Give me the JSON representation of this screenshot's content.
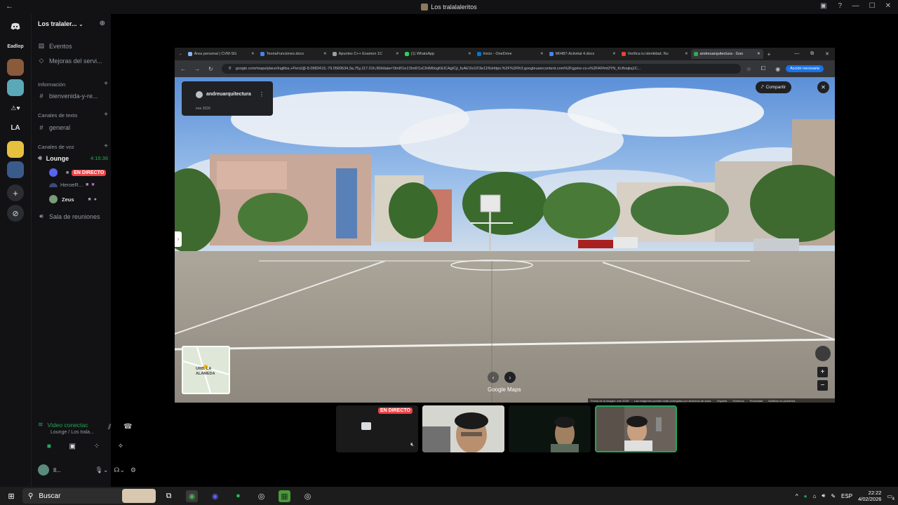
{
  "window": {
    "title": "Los tralalaleritos",
    "controls": [
      "—",
      "☐",
      "✕"
    ]
  },
  "rail": {
    "items": [
      {
        "name": "discord-home-icon",
        "label": ""
      },
      {
        "name": "server-eadlop",
        "label": "Eadlop"
      },
      {
        "name": "server-la",
        "label": "LA"
      }
    ]
  },
  "channels": {
    "server_name": "Los tralaler...",
    "events": "Eventos",
    "improvements": "Mejoras del servi...",
    "cat_info": "Información",
    "ch_welcome": "bienvenida-y-re...",
    "cat_text": "Canales de texto",
    "ch_general": "general",
    "cat_voice": "Canales de voz",
    "voice_lounge": "Lounge",
    "voice_timer": "4:16:36",
    "live_label": "EN DIRECTO",
    "user_heroe": "HeroeR...",
    "user_zeus": "Zeus",
    "meeting_room": "Sala de reuniones"
  },
  "voice_panel": {
    "status": "Video conectac",
    "sub": "Lounge / Los trala...",
    "username": "Il..."
  },
  "browser": {
    "tabs": [
      {
        "label": "Área personal | CVM-SG",
        "color": "#8ab4f8"
      },
      {
        "label": "TeoriaFunciones.docx",
        "color": "#4285f4"
      },
      {
        "label": "Apuntes C++ Examen 1C",
        "color": "#9aa0a6"
      },
      {
        "label": "(1) WhatsApp",
        "color": "#25d366"
      },
      {
        "label": "Inicio - OneDrive",
        "color": "#0078d4"
      },
      {
        "label": "M0487-Activitat 4.docx",
        "color": "#4285f4"
      },
      {
        "label": "Verifica tu identidad. Nu",
        "color": "#ea4335"
      },
      {
        "label": "andreuarquitectura - Goo",
        "color": "#34a853"
      }
    ],
    "url": "google.com/maps/place/Ingillos,+Perú/@-8.0983419,-79.0569534,3a,75y,117.01h,90t/data=!3m8!1e1!3m6!1sCIHM0ogKEICAgICji_fuAE!2e10!3e11!6shttps:%2F%2Flh3.googleusercontent.com%2Fgpms-cs-s%2FAFfmt2YN_Kcftoqkq1C...",
    "action_label": "Acción necesaria"
  },
  "maps": {
    "account": "andreuarquitectura",
    "date": "ene 2026",
    "share": "Compartir",
    "minimap_label": "URB. LA ALAMEDA",
    "brand": "Google Maps",
    "footer": [
      "Fecha de la imagen: ene 2025",
      "Las imágenes pueden estar protegidas por derechos de autor.",
      "España",
      "Términos",
      "Privacidad",
      "Notificar un problema"
    ]
  },
  "stream_thumbs": {
    "live_label": "EN DIRECTO"
  },
  "taskbar": {
    "search": "Buscar",
    "lang": "ESP",
    "time": "22:22",
    "date": "4/02/2026",
    "notif_count": "4"
  },
  "colors": {
    "live": "#ed4245",
    "online": "#23a55a",
    "bg": "#000000"
  }
}
